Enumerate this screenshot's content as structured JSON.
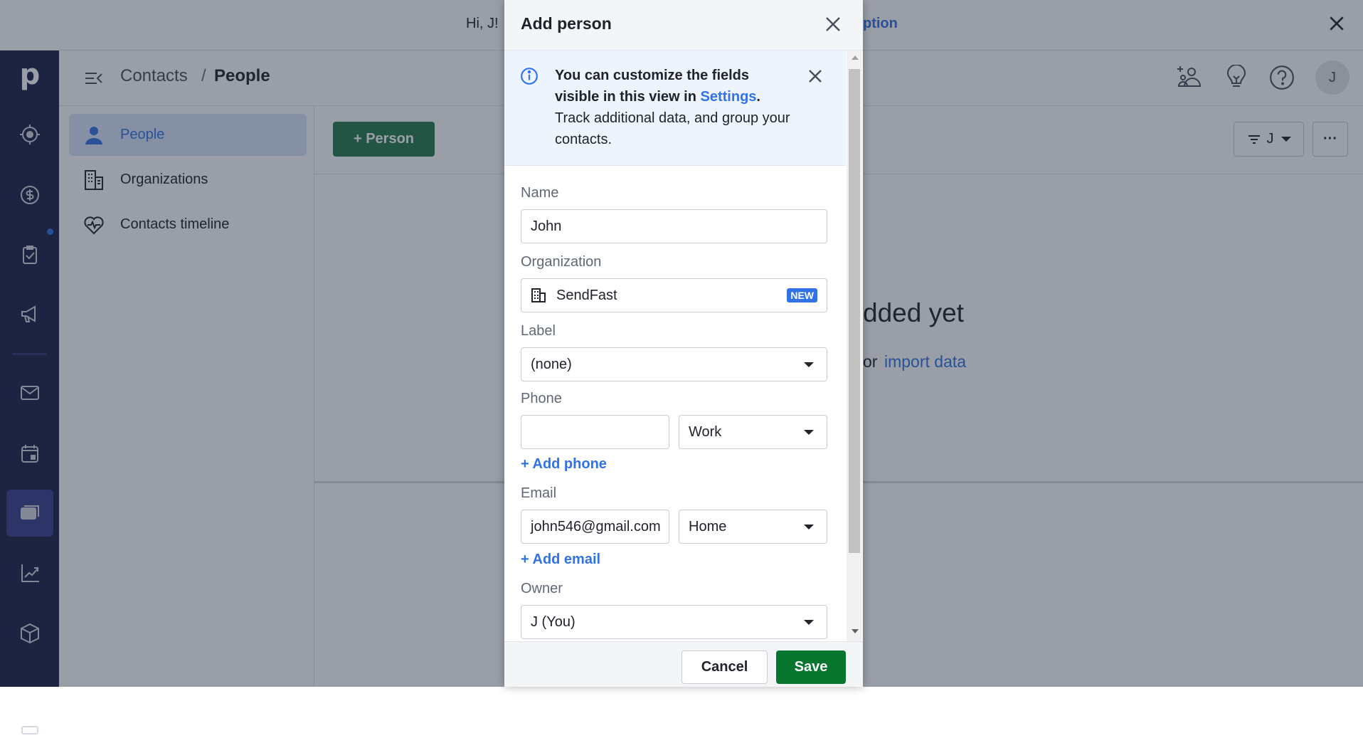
{
  "banner": {
    "greeting": "Hi, J!",
    "link_fragment": "ption"
  },
  "header": {
    "breadcrumb_parent": "Contacts",
    "breadcrumb_sep": "/",
    "breadcrumb_current": "People",
    "avatar": "J"
  },
  "subnav": {
    "items": [
      {
        "label": "People",
        "icon": "person-icon"
      },
      {
        "label": "Organizations",
        "icon": "building-icon"
      },
      {
        "label": "Contacts timeline",
        "icon": "heartbeat-icon"
      }
    ]
  },
  "main": {
    "add_button": "+ Person",
    "filter_label": "J",
    "more": "···",
    "empty_title_fragment": "dded yet",
    "empty_sub_prefix": "or",
    "empty_sub_link": "import data"
  },
  "modal": {
    "title": "Add person",
    "info": {
      "bold": "You can customize the fields visible in this view in",
      "link": "Settings",
      "period": ".",
      "rest": "Track additional data, and group your contacts."
    },
    "fields": {
      "name_label": "Name",
      "name_value": "John",
      "org_label": "Organization",
      "org_value": "SendFast",
      "org_badge": "NEW",
      "label_label": "Label",
      "label_value": "(none)",
      "phone_label": "Phone",
      "phone_value": "",
      "phone_type": "Work",
      "add_phone": "+ Add phone",
      "email_label": "Email",
      "email_value": "john546@gmail.com",
      "email_type": "Home",
      "add_email": "+ Add email",
      "owner_label": "Owner",
      "owner_value": "J (You)"
    },
    "cancel": "Cancel",
    "save": "Save"
  },
  "colors": {
    "accent": "#3173e6",
    "save_green": "#08752f",
    "nav_bg": "#1c2145",
    "person_btn": "#267a4c"
  }
}
